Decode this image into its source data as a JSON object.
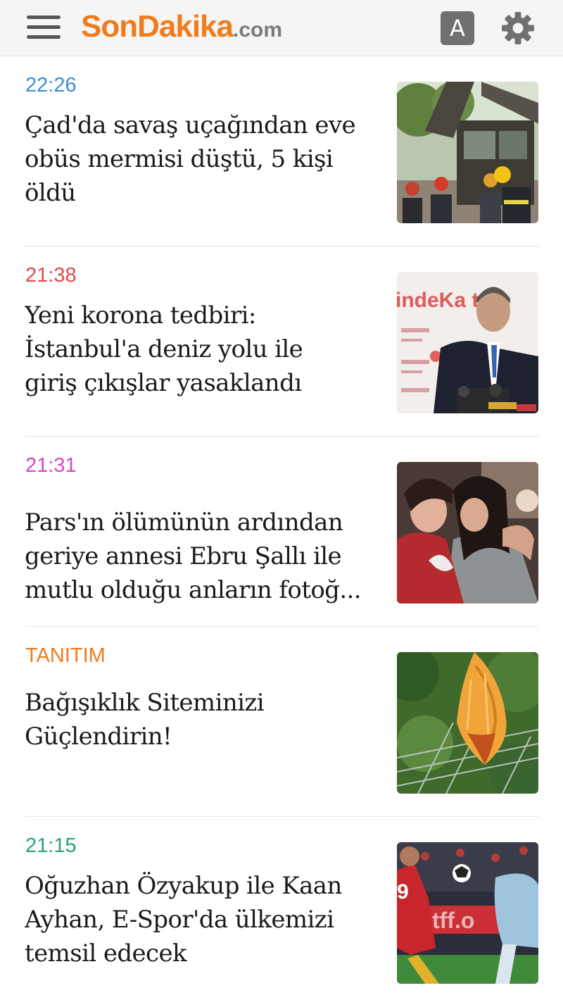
{
  "header": {
    "logo_brand": "SonDakika",
    "logo_tld": ".com",
    "font_button_label": "A"
  },
  "colors": {
    "accent": "#f07c1b",
    "time_blue": "#3a8fd8",
    "time_red": "#e24a4a",
    "time_magenta": "#d646c9",
    "promo_orange": "#f07c1b",
    "time_green": "#2aa37a"
  },
  "news": [
    {
      "time": "22:26",
      "time_color": "#3a8fd8",
      "title_lines": [
        "Çad'da savaş uçağından eve",
        "obüs mermisi düştü, 5 kişi",
        "öldü"
      ]
    },
    {
      "time": "21:38",
      "time_color": "#e24a4a",
      "title_lines": [
        "Yeni korona tedbiri:",
        "İstanbul'a deniz yolu ile",
        "giriş çıkışlar yasaklandı"
      ]
    },
    {
      "time": "21:31",
      "time_color": "#d646c9",
      "title_lines": [
        "Pars'ın ölümünün ardından",
        "geriye annesi Ebru Şallı ile",
        "mutlu olduğu anların fotoğ..."
      ]
    },
    {
      "time": "TANITIM",
      "time_color": "#f07c1b",
      "title_lines": [
        "Bağışıklık Siteminizi",
        "Güçlendirin!"
      ]
    },
    {
      "time": "21:15",
      "time_color": "#2aa37a",
      "title_lines": [
        "Oğuzhan Özyakup ile Kaan",
        "Ayhan, E-Spor'da ülkemizi",
        "temsil edecek"
      ]
    }
  ],
  "thumbnails": {
    "item_2_sign_text": "indeKa ta"
  }
}
